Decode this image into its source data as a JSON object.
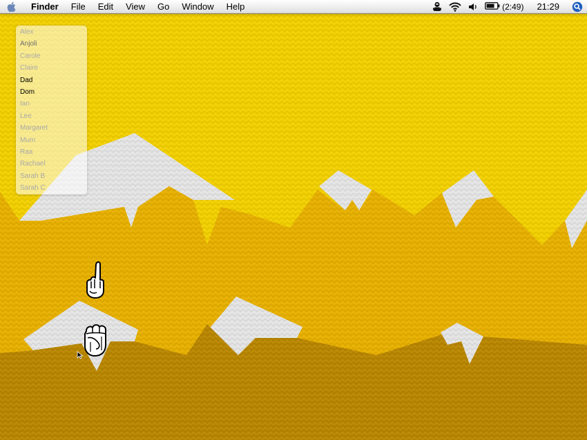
{
  "menubar": {
    "app_name": "Finder",
    "menus": [
      "File",
      "Edit",
      "View",
      "Go",
      "Window",
      "Help"
    ],
    "battery_text": "(2:49)",
    "clock": "21:29",
    "icons": {
      "apple": "apple-logo-icon",
      "user": "user-figure-icon",
      "wifi": "wifi-icon",
      "volume": "volume-icon",
      "battery": "battery-icon",
      "spotlight": "spotlight-search-icon"
    }
  },
  "user_list": {
    "items": [
      {
        "label": "Alex",
        "state": "dim"
      },
      {
        "label": "Anjoli",
        "state": "semi"
      },
      {
        "label": "Carole",
        "state": "dim"
      },
      {
        "label": "Claire",
        "state": "dim"
      },
      {
        "label": "Dad",
        "state": "active"
      },
      {
        "label": "Dom",
        "state": "active"
      },
      {
        "label": "Ian",
        "state": "dim"
      },
      {
        "label": "Lee",
        "state": "dim"
      },
      {
        "label": "Margaret",
        "state": "dim"
      },
      {
        "label": "Mum",
        "state": "dim"
      },
      {
        "label": "Raa",
        "state": "dim"
      },
      {
        "label": "Rachael",
        "state": "dim"
      },
      {
        "label": "Sarah B",
        "state": "dim"
      },
      {
        "label": "Sarah C",
        "state": "dim"
      }
    ]
  },
  "colors": {
    "sky": "#f2d000",
    "mountain_mid": "#e7b000",
    "mountain_front": "#b98600",
    "snow": "#e4e4e4"
  }
}
